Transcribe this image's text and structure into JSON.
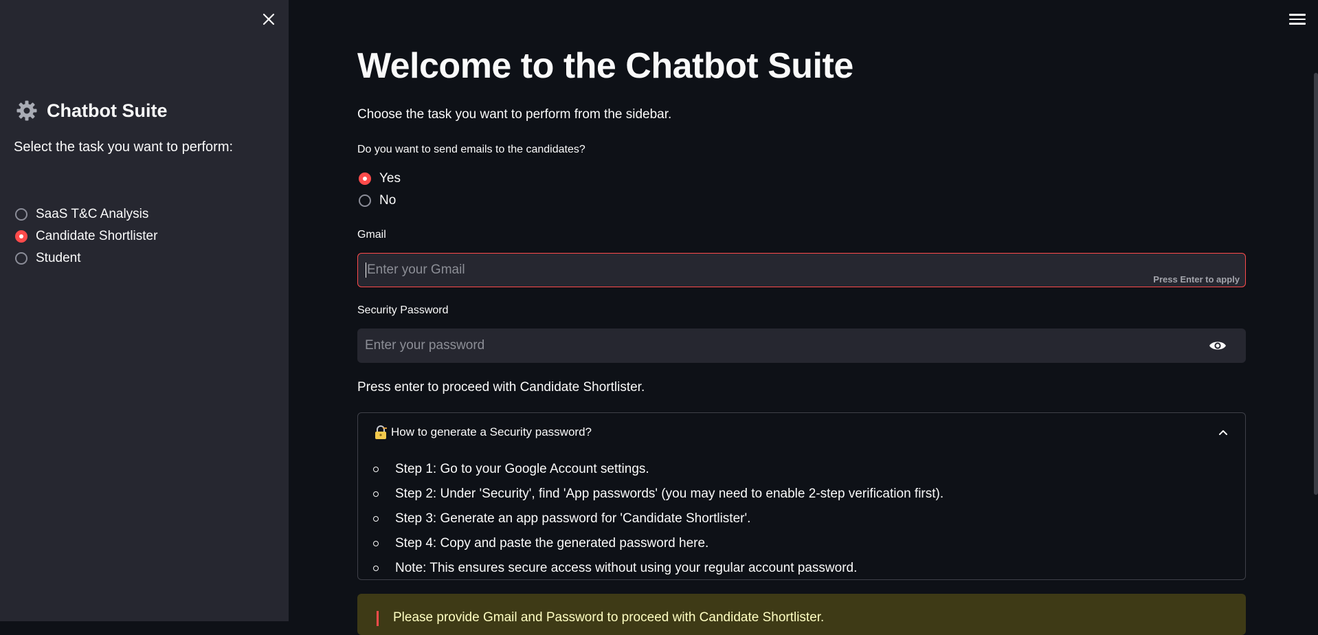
{
  "sidebar": {
    "title": "Chatbot Suite",
    "title_icon": "gear-icon",
    "prompt": "Select the task you want to perform:",
    "options": [
      {
        "label": "SaaS T&C Analysis",
        "selected": false
      },
      {
        "label": "Candidate Shortlister",
        "selected": true
      },
      {
        "label": "Student",
        "selected": false
      }
    ]
  },
  "main": {
    "title": "Welcome to the Chatbot Suite",
    "subtitle": "Choose the task you want to perform from the sidebar.",
    "email_question": "Do you want to send emails to the candidates?",
    "email_options": [
      {
        "label": "Yes",
        "selected": true
      },
      {
        "label": "No",
        "selected": false
      }
    ],
    "gmail": {
      "label": "Gmail",
      "placeholder": "Enter your Gmail",
      "value": "",
      "hint": "Press Enter to apply"
    },
    "password": {
      "label": "Security Password",
      "placeholder": "Enter your password",
      "value": ""
    },
    "proceed_text": "Press enter to proceed with Candidate Shortlister.",
    "expander": {
      "title": "How to generate a Security password?",
      "icon": "lock-key-icon",
      "expanded": true,
      "steps": [
        "Step 1: Go to your Google Account settings.",
        "Step 2: Under 'Security', find 'App passwords' (you may need to enable 2-step verification first).",
        "Step 3: Generate an app password for 'Candidate Shortlister'.",
        "Step 4: Copy and paste the generated password here.",
        "Note: This ensures secure access without using your regular account password."
      ]
    },
    "warning": "Please provide Gmail and Password to proceed with Candidate Shortlister."
  },
  "colors": {
    "accent": "#ff4b4b",
    "background": "#0e1117",
    "sidebar": "#262730",
    "warning_bg": "#3e3a16"
  }
}
